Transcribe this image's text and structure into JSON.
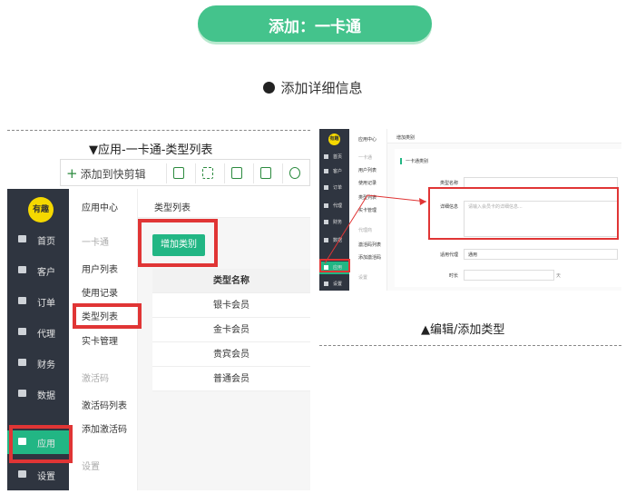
{
  "banner": {
    "text": "添加：一卡通"
  },
  "heading": {
    "text": "添加详细信息"
  },
  "left": {
    "caption": "▼应用-一卡通-类型列表",
    "toolbar": {
      "add_label": "添加到快剪辑",
      "icons": [
        "monitor-icon",
        "expand-icon",
        "save-icon",
        "share-icon",
        "gear-icon"
      ]
    },
    "logo": "有趣",
    "nav": [
      "首页",
      "客户",
      "订单",
      "代理",
      "财务",
      "数据",
      "应用",
      "设置"
    ],
    "menu": {
      "header": "应用中心",
      "group1": "一卡通",
      "items1": [
        "用户列表",
        "使用记录",
        "类型列表",
        "实卡管理"
      ],
      "group2": "激活码",
      "items2": [
        "激活码列表",
        "添加激活码"
      ],
      "group3": "设置"
    },
    "main": {
      "title": "类型列表",
      "add_button": "增加类别",
      "column": "类型名称",
      "rows": [
        "银卡会员",
        "金卡会员",
        "贵宾会员",
        "普通会员"
      ]
    }
  },
  "right": {
    "caption": "▲编辑/添加类型",
    "logo": "有趣",
    "nav": [
      "首页",
      "客户",
      "订单",
      "代理",
      "财务",
      "数据",
      "应用",
      "设置"
    ],
    "menu": {
      "header": "应用中心",
      "group1": "一卡通",
      "items1": [
        "用户列表",
        "使用记录",
        "类型列表",
        "实卡管理"
      ],
      "group2": "代理商",
      "items2": [
        "激活码列表",
        "添加激活码"
      ],
      "group3": "设置"
    },
    "main": {
      "breadcrumb": "增加类别",
      "section": "一卡通类别",
      "name_label": "类型名称",
      "detail_label": "详细信息",
      "detail_placeholder": "请输入会员卡的详细信息...",
      "agent_label": "适用代理",
      "agent_value": "通用",
      "duration_label": "时长",
      "duration_unit": "天"
    }
  }
}
